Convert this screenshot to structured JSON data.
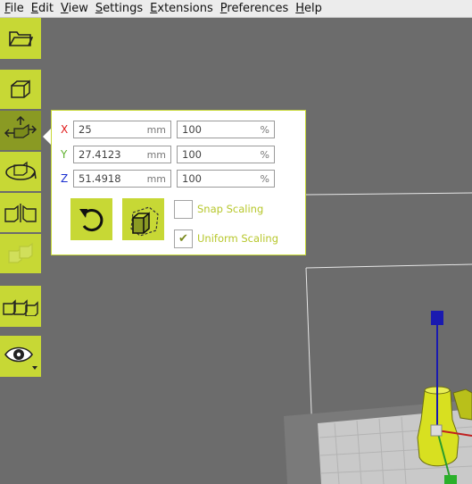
{
  "menubar": {
    "items": [
      {
        "mnemonic": "F",
        "rest": "ile"
      },
      {
        "mnemonic": "E",
        "rest": "dit"
      },
      {
        "mnemonic": "V",
        "rest": "iew"
      },
      {
        "mnemonic": "S",
        "rest": "ettings"
      },
      {
        "mnemonic": "E",
        "rest": "xtensions"
      },
      {
        "mnemonic": "P",
        "rest": "references"
      },
      {
        "mnemonic": "H",
        "rest": "elp"
      }
    ]
  },
  "toolbar": {
    "tools": [
      {
        "icon": "open-file-icon"
      },
      {
        "icon": "translate-icon"
      },
      {
        "icon": "scale-icon",
        "active": true
      },
      {
        "icon": "rotate-icon"
      },
      {
        "icon": "mirror-icon"
      },
      {
        "icon": "per-object-settings-icon",
        "disabled": true
      },
      {
        "icon": "support-blocker-icon"
      },
      {
        "icon": "view-mode-icon"
      }
    ],
    "accent_color": "#c7d835",
    "active_color": "#8a9a23"
  },
  "scale_panel": {
    "x": {
      "label": "X",
      "color": "#e01818",
      "size": "25",
      "size_unit": "mm",
      "percent": "100",
      "percent_unit": "%"
    },
    "y": {
      "label": "Y",
      "color": "#5fb12e",
      "size": "27.4123",
      "size_unit": "mm",
      "percent": "100",
      "percent_unit": "%"
    },
    "z": {
      "label": "Z",
      "color": "#1a2fd0",
      "size": "51.4918",
      "size_unit": "mm",
      "percent": "100",
      "percent_unit": "%"
    },
    "reset_button_icon": "undo-icon",
    "lay_flat_button_icon": "lay-flat-icon",
    "snap_scaling": {
      "label": "Snap Scaling",
      "checked": false
    },
    "uniform_scaling": {
      "label": "Uniform Scaling",
      "checked": true
    }
  },
  "scene": {
    "model_color": "#d8e020",
    "z_handle_color": "#1a1ab0"
  }
}
